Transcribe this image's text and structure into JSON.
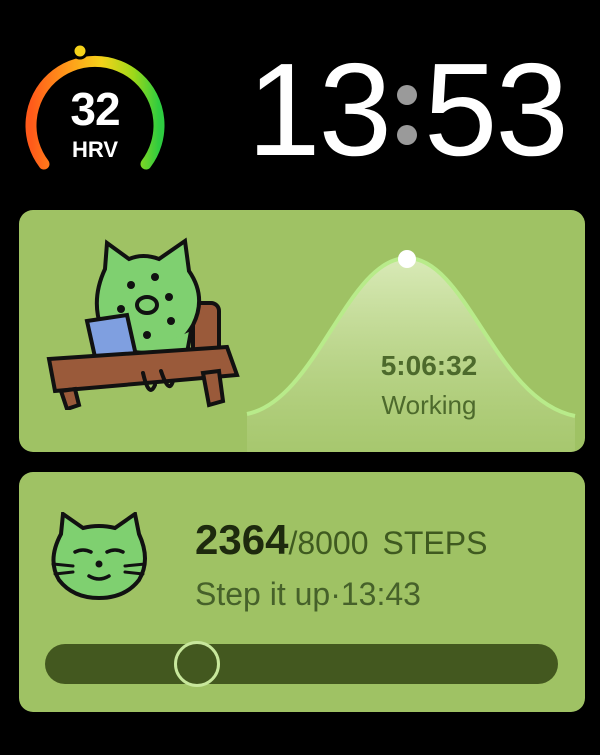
{
  "status_bar": {
    "hrv_value": "32",
    "hrv_label": "HRV",
    "time_hours": "13",
    "time_minutes": "53"
  },
  "work_card": {
    "timer": "5:06:32",
    "status": "Working"
  },
  "steps_card": {
    "count": "2364",
    "goal": "/8000",
    "unit": "STEPS",
    "note": "Step it up·13:43",
    "progress_fraction": 0.2955
  },
  "colors": {
    "background": "#000000",
    "card_green": "#9fc264",
    "accent_dark_green": "#43581f",
    "hrv_gauge_gradient": [
      "#ff5a1a",
      "#ff9d1a",
      "#f5d21a",
      "#9ed81a",
      "#2ecc40"
    ]
  },
  "icons": {
    "hrv_gauge": "gauge-icon",
    "work_character": "cat-at-laptop-icon",
    "steps_character": "cat-face-icon"
  }
}
